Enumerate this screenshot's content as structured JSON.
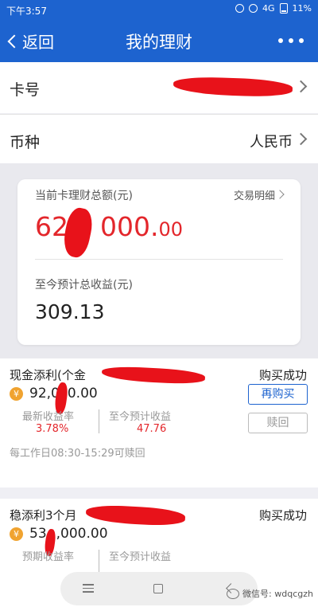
{
  "status_bar": {
    "time": "下午3:57",
    "network": "4G",
    "battery": "11%"
  },
  "nav": {
    "back_label": "返回",
    "title": "我的理财"
  },
  "card_row": {
    "label": "卡号"
  },
  "currency_row": {
    "label": "币种",
    "value": "人民币"
  },
  "summary": {
    "total_label": "当前卡理财总额(元)",
    "detail_link": "交易明细",
    "total_amount_int": "62",
    "total_amount_mid": "000.",
    "total_amount_dec": "00",
    "earnings_label": "至今预计总收益(元)",
    "earnings_value": "309.13"
  },
  "products": [
    {
      "name": "现金添利(个金",
      "status": "购买成功",
      "currency_symbol": "¥",
      "amount_left": "92,0",
      "amount_right": "0.00",
      "col1_label": "最新收益率",
      "col1_value": "3.78%",
      "col2_label": "至今预计收益",
      "col2_value": "47.76",
      "buy_again": "再购买",
      "redeem": "赎回",
      "note": "每工作日08:30-15:29可赎回"
    },
    {
      "name": "稳添利3个月",
      "status": "购买成功",
      "currency_symbol": "¥",
      "amount_left": "53",
      "amount_right": ",000.00",
      "col1_label": "预期收益率",
      "col2_label": "至今预计收益"
    }
  ],
  "watermark": {
    "text": "微信号: wdqcgzh"
  },
  "colors": {
    "brand_blue": "#1d63cf",
    "amount_red": "#e3262b",
    "redaction_red": "#e8121a",
    "coin_orange": "#f0a330"
  },
  "icons": [
    "back-chevron-icon",
    "more-dots-icon",
    "chevron-right-icon",
    "yuan-coin-icon",
    "menu-icon",
    "home-icon",
    "back-icon",
    "wechat-logo-icon"
  ]
}
